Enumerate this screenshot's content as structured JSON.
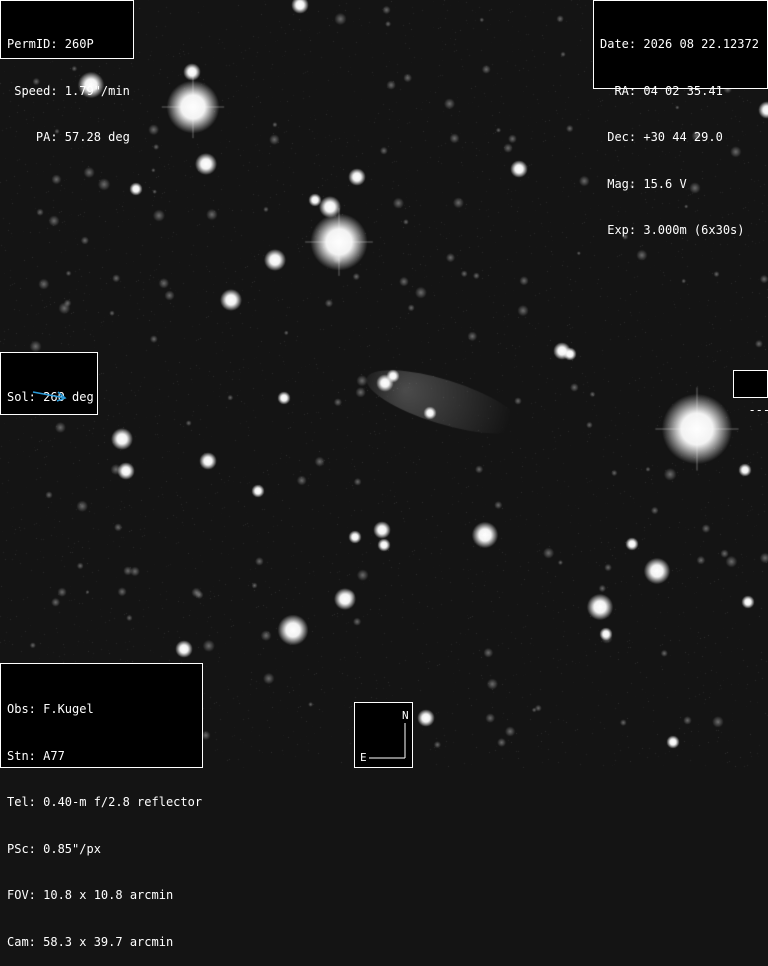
{
  "target": {
    "lines": [
      "PermID: 260P",
      " Speed: 1.79\"/min",
      "    PA: 57.28 deg"
    ]
  },
  "ephemeris": {
    "lines": [
      "Date: 2026 08 22.12372",
      "  RA: 04 02 35.41",
      " Dec: +30 44 29.0",
      " Mag: 15.6 V",
      " Exp: 3.000m (6x30s)"
    ]
  },
  "solar": {
    "label": "Sol: 260 deg",
    "arrow_color": "#2a9ad8",
    "arrow_icon": "arrow-right-icon"
  },
  "side_marker": {
    "label": "---"
  },
  "observatory": {
    "lines": [
      "Obs: F.Kugel",
      "Stn: A77",
      "Tel: 0.40-m f/2.8 reflector",
      "PSc: 0.85\"/px",
      "FOV: 10.8 x 10.8 arcmin",
      "Cam: 58.3 x 39.7 arcmin"
    ]
  },
  "compass": {
    "north": "N",
    "east": "E"
  },
  "colors": {
    "sky": "#141414",
    "panel_bg": "#000000",
    "text": "#ffffff"
  }
}
